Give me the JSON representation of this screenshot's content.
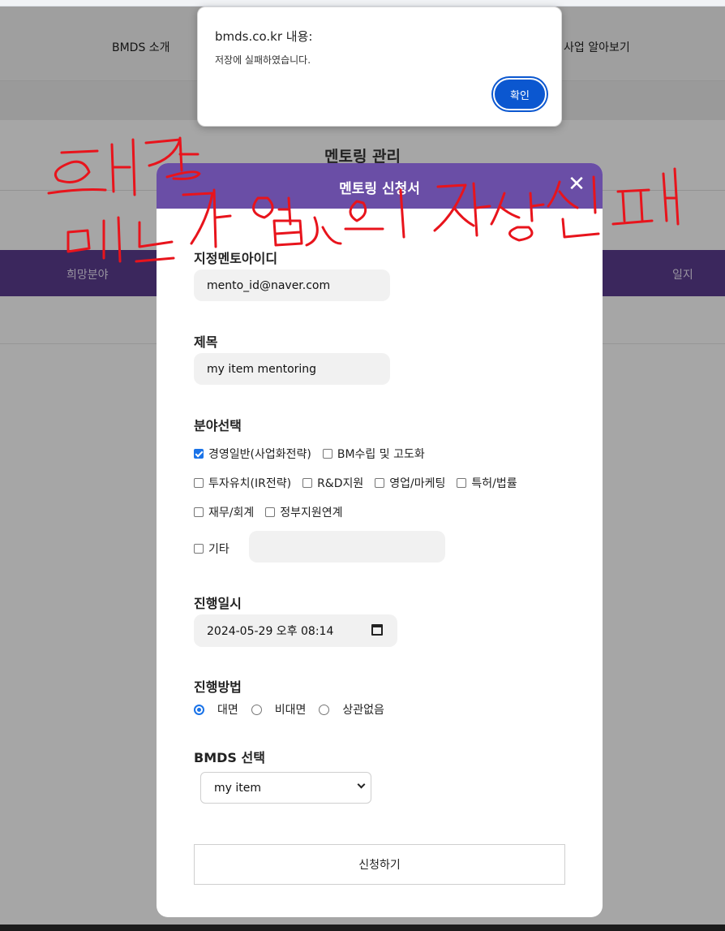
{
  "background": {
    "nav_left": "BMDS 소개",
    "nav_right": "사업 알아보기",
    "page_title": "멘토링 관리",
    "tab_left": "희망분야",
    "tab_right": "일지"
  },
  "alert": {
    "title": "bmds.co.kr 내용:",
    "message": "저장에 실패하였습니다.",
    "ok_label": "확인"
  },
  "modal": {
    "title": "멘토링 신청서",
    "close_glyph": "✕",
    "mentor_id": {
      "label": "지정멘토아이디",
      "value": "mento_id@naver.com"
    },
    "subject": {
      "label": "제목",
      "value": "my item mentoring"
    },
    "fields": {
      "label": "분야선택",
      "rows": [
        [
          {
            "label": "경영일반(사업화전략)",
            "checked": true
          },
          {
            "label": "BM수립 및 고도화",
            "checked": false
          }
        ],
        [
          {
            "label": "투자유치(IR전략)",
            "checked": false
          },
          {
            "label": "R&D지원",
            "checked": false
          },
          {
            "label": "영업/마케팅",
            "checked": false
          },
          {
            "label": "특허/법률",
            "checked": false
          }
        ],
        [
          {
            "label": "재무/회계",
            "checked": false
          },
          {
            "label": "정부지원연계",
            "checked": false
          }
        ]
      ],
      "etc_label": "기타",
      "etc_value": ""
    },
    "datetime": {
      "label": "진행일시",
      "value": "2024-05-29 오후 08:14"
    },
    "method": {
      "label": "진행방법",
      "options": [
        "대면",
        "비대면",
        "상관없음"
      ],
      "selected": "대면"
    },
    "bmds": {
      "label": "BMDS 선택",
      "selected": "my item"
    },
    "submit_label": "신청하기"
  },
  "colors": {
    "header_purple": "#6a4ea6",
    "tab_purple": "#5b3d8f",
    "accent_blue": "#1a73e8",
    "alert_button": "#0b57d0",
    "annotation_red": "#e8141c"
  }
}
